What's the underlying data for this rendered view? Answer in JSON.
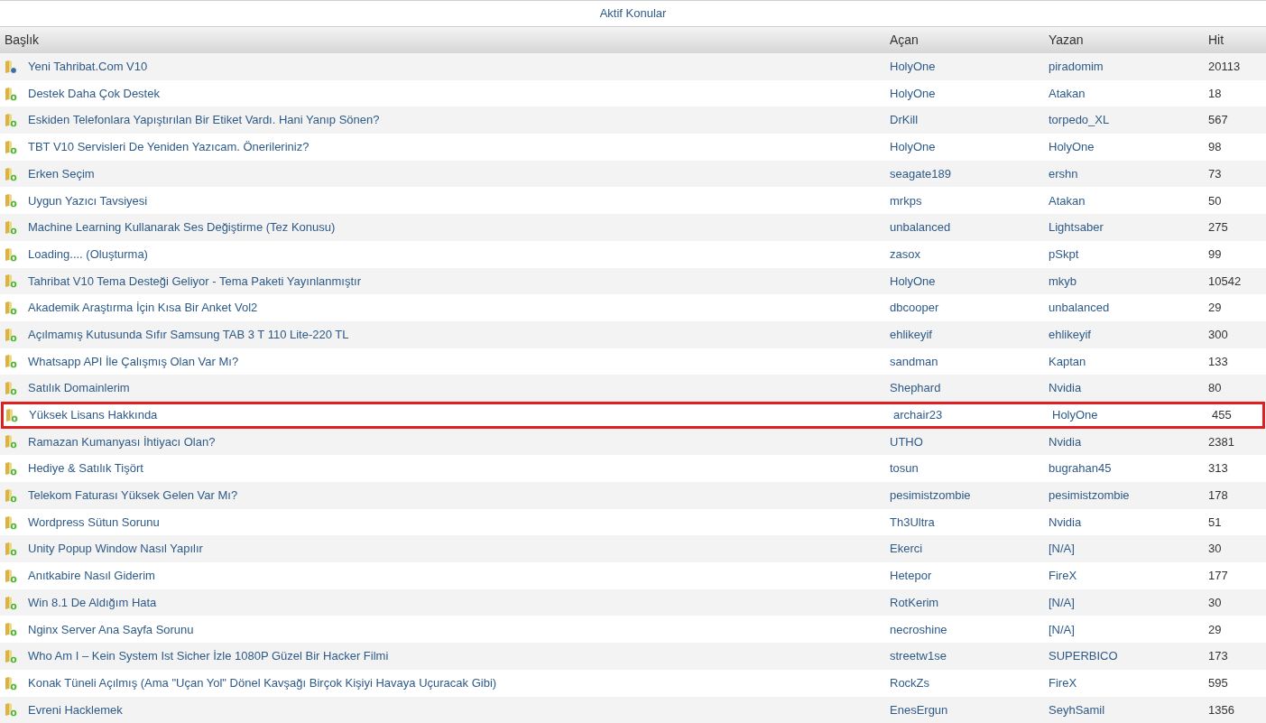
{
  "title": "Aktif Konular",
  "columns": [
    "Başlık",
    "Açan",
    "Yazan",
    "Hit"
  ],
  "rows": [
    {
      "kind": "sticky",
      "title": "Yeni Tahribat.Com V10",
      "opener": "HolyOne",
      "writer": "piradomim",
      "hits": "20113",
      "highlighted": false
    },
    {
      "kind": "new",
      "title": "Destek Daha Çok Destek",
      "opener": "HolyOne",
      "writer": "Atakan",
      "hits": "18",
      "highlighted": false
    },
    {
      "kind": "new",
      "title": "Eskiden Telefonlara Yapıştırılan Bir Etiket Vardı. Hani Yanıp Sönen?",
      "opener": "DrKill",
      "writer": "torpedo_XL",
      "hits": "567",
      "highlighted": false
    },
    {
      "kind": "new",
      "title": "TBT V10 Servisleri De Yeniden Yazıcam. Önerileriniz?",
      "opener": "HolyOne",
      "writer": "HolyOne",
      "hits": "98",
      "highlighted": false
    },
    {
      "kind": "new",
      "title": "Erken Seçim",
      "opener": "seagate189",
      "writer": "ershn",
      "hits": "73",
      "highlighted": false
    },
    {
      "kind": "new",
      "title": "Uygun Yazıcı Tavsiyesi",
      "opener": "mrkps",
      "writer": "Atakan",
      "hits": "50",
      "highlighted": false
    },
    {
      "kind": "new",
      "title": "Machine Learning Kullanarak Ses Değiştirme (Tez Konusu)",
      "opener": "unbalanced",
      "writer": "Lightsaber",
      "hits": "275",
      "highlighted": false
    },
    {
      "kind": "new",
      "title": "Loading.... (Oluşturma)",
      "opener": "zasox",
      "writer": "pSkpt",
      "hits": "99",
      "highlighted": false
    },
    {
      "kind": "new",
      "title": "Tahribat V10 Tema Desteği Geliyor - Tema Paketi Yayınlanmıştır",
      "opener": "HolyOne",
      "writer": "mkyb",
      "hits": "10542",
      "highlighted": false
    },
    {
      "kind": "new",
      "title": "Akademik Araştırma İçin Kısa Bir Anket Vol2",
      "opener": "dbcooper",
      "writer": "unbalanced",
      "hits": "29",
      "highlighted": false
    },
    {
      "kind": "new",
      "title": "Açılmamış Kutusunda Sıfır Samsung TAB 3 T 110 Lite-220 TL",
      "opener": "ehlikeyif",
      "writer": "ehlikeyif",
      "hits": "300",
      "highlighted": false
    },
    {
      "kind": "new",
      "title": "Whatsapp API İle Çalışmış Olan Var Mı?",
      "opener": "sandman",
      "writer": "Kaptan",
      "hits": "133",
      "highlighted": false
    },
    {
      "kind": "new",
      "title": "Satılık Domainlerim",
      "opener": "Shephard",
      "writer": "Nvidia",
      "hits": "80",
      "highlighted": false
    },
    {
      "kind": "new",
      "title": "Yüksek Lisans Hakkında",
      "opener": "archair23",
      "writer": "HolyOne",
      "hits": "455",
      "highlighted": true
    },
    {
      "kind": "new",
      "title": "Ramazan Kumanyası İhtiyacı Olan?",
      "opener": "UTHO",
      "writer": "Nvidia",
      "hits": "2381",
      "highlighted": false
    },
    {
      "kind": "new",
      "title": "Hediye & Satılık Tişört",
      "opener": "tosun",
      "writer": "bugrahan45",
      "hits": "313",
      "highlighted": false
    },
    {
      "kind": "new",
      "title": "Telekom Faturası Yüksek Gelen Var Mı?",
      "opener": "pesimistzombie",
      "writer": "pesimistzombie",
      "hits": "178",
      "highlighted": false
    },
    {
      "kind": "new",
      "title": "Wordpress Sütun Sorunu",
      "opener": "Th3Ultra",
      "writer": "Nvidia",
      "hits": "51",
      "highlighted": false
    },
    {
      "kind": "new",
      "title": "Unity Popup Window Nasıl Yapılır",
      "opener": "Ekerci",
      "writer": "[N/A]",
      "hits": "30",
      "highlighted": false
    },
    {
      "kind": "new",
      "title": "Anıtkabire Nasıl Giderim",
      "opener": "Hetepor",
      "writer": "FireX",
      "hits": "177",
      "highlighted": false
    },
    {
      "kind": "new",
      "title": "Win 8.1 De Aldığım Hata",
      "opener": "RotKerim",
      "writer": "[N/A]",
      "hits": "30",
      "highlighted": false
    },
    {
      "kind": "new",
      "title": "Nginx Server Ana Sayfa Sorunu",
      "opener": "necroshine",
      "writer": "[N/A]",
      "hits": "29",
      "highlighted": false
    },
    {
      "kind": "new",
      "title": "Who Am I – Kein System Ist Sicher İzle 1080P Güzel Bir Hacker Filmi",
      "opener": "streetw1se",
      "writer": "SUPERBICO",
      "hits": "173",
      "highlighted": false
    },
    {
      "kind": "new",
      "title": "Konak Tüneli Açılmış (Ama \"Uçan Yol\" Dönel Kavşağı Birçok Kişiyi Havaya Uçuracak Gibi)",
      "opener": "RockZs",
      "writer": "FireX",
      "hits": "595",
      "highlighted": false
    },
    {
      "kind": "new",
      "title": "Evreni Hacklemek",
      "opener": "EnesErgun",
      "writer": "SeyhSamil",
      "hits": "1356",
      "highlighted": false
    }
  ]
}
